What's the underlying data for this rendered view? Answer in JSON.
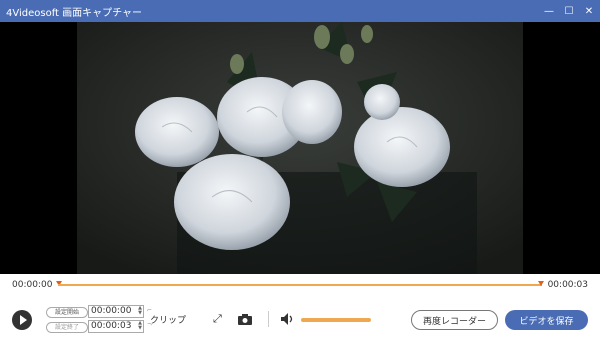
{
  "window": {
    "title": "4Videosoft 画面キャプチャー",
    "controls": [
      "minimize-icon",
      "maximize-icon",
      "close-icon"
    ]
  },
  "timeline": {
    "start_time": "00:00:00",
    "end_time": "00:00:03",
    "accent_color": "#f0a850"
  },
  "clip": {
    "start_label": "設定開始",
    "start_value": "00:00:00",
    "end_label": "設定終了",
    "end_value": "00:00:03",
    "clip_label": "クリップ"
  },
  "volume": {
    "level": 0.75
  },
  "buttons": {
    "rerecord": "再度レコーダー",
    "save": "ビデオを保存"
  },
  "theme": {
    "brand": "#4a6cb4"
  }
}
